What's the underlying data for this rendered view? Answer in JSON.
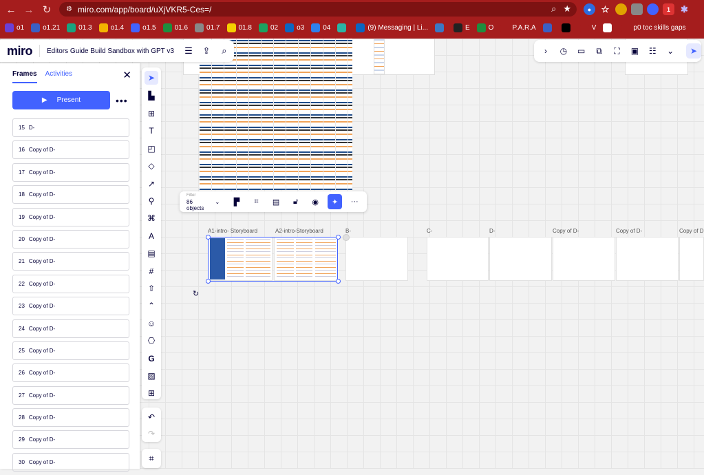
{
  "browser": {
    "url": "miro.com/app/board/uXjVKR5-Ces=/",
    "bookmarks": [
      {
        "label": "o1",
        "color": "#6b3fd6"
      },
      {
        "label": "o1.21",
        "color": "#3b5fc4"
      },
      {
        "label": "01.3",
        "color": "#19a37f"
      },
      {
        "label": "o1.4",
        "color": "#f4b400"
      },
      {
        "label": "o1.5",
        "color": "#4262ff"
      },
      {
        "label": "01.6",
        "color": "#1e8e3e"
      },
      {
        "label": "01.7",
        "color": "#888888"
      },
      {
        "label": "01.8",
        "color": "#f5d000"
      },
      {
        "label": "02",
        "color": "#1aa260"
      },
      {
        "label": "o3",
        "color": "#0a66c2"
      },
      {
        "label": "04",
        "color": "#2f80ed"
      },
      {
        "label": "",
        "color": "#2bb5a4"
      },
      {
        "label": "(9) Messaging | Li...",
        "color": "#0a66c2"
      },
      {
        "label": "",
        "color": "#3b78c4"
      },
      {
        "label": "E",
        "color": "#222222"
      },
      {
        "label": "O",
        "color": "#1e8e3e"
      },
      {
        "label": "P.A.R.A",
        "color": "#a51d1d"
      },
      {
        "label": "",
        "color": "#3b5fc4"
      },
      {
        "label": "",
        "color": "#000000"
      },
      {
        "label": "V",
        "color": "#a51d1d"
      },
      {
        "label": "",
        "color": "#ffffff"
      },
      {
        "label": "p0 toc skills gaps",
        "color": "#a51d1d"
      }
    ]
  },
  "header": {
    "logo": "miro",
    "board_name": "Editors Guide Build Sandbox with GPT v3"
  },
  "panel": {
    "tabs": [
      {
        "label": "Frames",
        "active": true
      },
      {
        "label": "Activities",
        "active": false
      }
    ],
    "present_label": "Present",
    "frames": [
      {
        "num": "15",
        "title": "D-"
      },
      {
        "num": "16",
        "title": "Copy of D-"
      },
      {
        "num": "17",
        "title": "Copy of D-"
      },
      {
        "num": "18",
        "title": "Copy of D-"
      },
      {
        "num": "19",
        "title": "Copy of D-"
      },
      {
        "num": "20",
        "title": "Copy of D-"
      },
      {
        "num": "21",
        "title": "Copy of D-"
      },
      {
        "num": "22",
        "title": "Copy of D-"
      },
      {
        "num": "23",
        "title": "Copy of D-"
      },
      {
        "num": "24",
        "title": "Copy of D-"
      },
      {
        "num": "25",
        "title": "Copy of D-"
      },
      {
        "num": "26",
        "title": "Copy of D-"
      },
      {
        "num": "27",
        "title": "Copy of D-"
      },
      {
        "num": "28",
        "title": "Copy of D-"
      },
      {
        "num": "29",
        "title": "Copy of D-"
      },
      {
        "num": "30",
        "title": "Copy of D-"
      }
    ]
  },
  "context_toolbar": {
    "filter_label": "Filter",
    "objects_count": "86 objects"
  },
  "canvas_frames": [
    {
      "label": "A1-intro- Storyboard"
    },
    {
      "label": "A2-intro-Storyboard"
    },
    {
      "label": "B-"
    },
    {
      "label": "C-"
    },
    {
      "label": "D-"
    },
    {
      "label": "Copy of D-"
    },
    {
      "label": "Copy of D-"
    },
    {
      "label": "Copy of D"
    }
  ],
  "colors": {
    "browser_chrome": "#a51d1d",
    "accent": "#4262ff"
  }
}
